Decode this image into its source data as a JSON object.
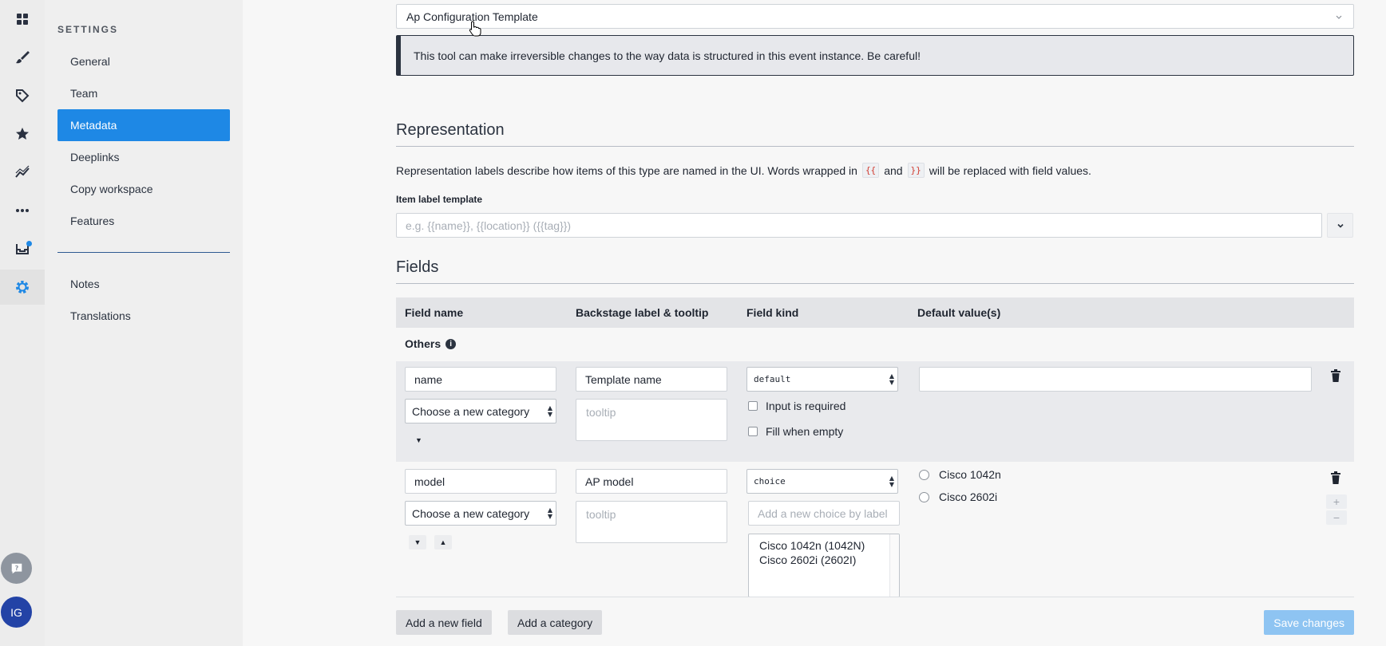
{
  "rail": {
    "icons": [
      "dashboard-icon",
      "brush-icon",
      "tags-icon",
      "star-icon",
      "analytics-icon",
      "more-icon",
      "inbox-icon",
      "settings-icon"
    ],
    "avatar_initials": "IG"
  },
  "subnav": {
    "heading": "SETTINGS",
    "items": [
      {
        "label": "General"
      },
      {
        "label": "Team"
      },
      {
        "label": "Metadata"
      },
      {
        "label": "Deeplinks"
      },
      {
        "label": "Copy workspace"
      },
      {
        "label": "Features"
      }
    ],
    "secondary_items": [
      {
        "label": "Notes"
      },
      {
        "label": "Translations"
      }
    ]
  },
  "main": {
    "template_select": "Ap Configuration Template",
    "warning": "This tool can make irreversible changes to the way data is structured in this event instance. Be careful!",
    "representation": {
      "title": "Representation",
      "desc_before": "Representation labels describe how items of this type are named in the UI. Words wrapped in",
      "open_token": "{{",
      "desc_and": "and",
      "close_token": "}}",
      "desc_after": "will be replaced with field values.",
      "item_label_template_label": "Item label template",
      "item_label_template_placeholder": "e.g. {{name}}, {{location}} ({{tag}})"
    },
    "fields": {
      "title": "Fields",
      "headers": {
        "field_name": "Field name",
        "backstage": "Backstage label & tooltip",
        "field_kind": "Field kind",
        "default_values": "Default value(s)"
      },
      "group_name": "Others",
      "rows": [
        {
          "name": "name",
          "category": "Choose a new category",
          "label": "Template name",
          "tooltip_placeholder": "tooltip",
          "kind": "default",
          "required_label": "Input is required",
          "fill_label": "Fill when empty"
        },
        {
          "name": "model",
          "category": "Choose a new category",
          "label": "AP model",
          "tooltip_placeholder": "tooltip",
          "kind": "choice",
          "choice_placeholder": "Add a new choice by label",
          "choices_text": [
            "Cisco 1042n (1042N)",
            "Cisco 2602i (2602I)"
          ],
          "default_options": [
            "Cisco 1042n",
            "Cisco 2602i"
          ]
        }
      ]
    },
    "footer": {
      "add_field": "Add a new field",
      "add_category": "Add a category",
      "save": "Save changes"
    }
  },
  "colors": {
    "accent": "#1e88e5",
    "save_disabled": "#8ec4f2"
  }
}
